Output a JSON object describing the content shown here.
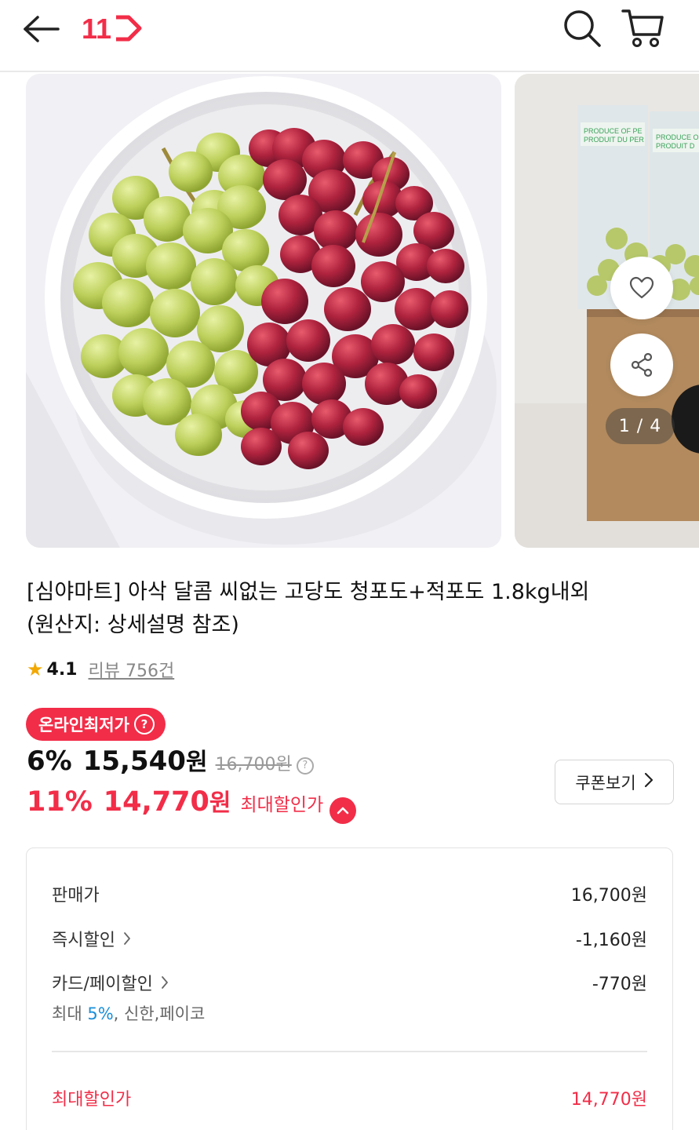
{
  "header": {
    "logo_text": "11",
    "brand_color": "#f22d48"
  },
  "gallery": {
    "page_indicator": "1 / 4",
    "package_label_1": "PRODUCE OF PE\nPRODUIT DU PER",
    "package_label_2": "PRODUCE O\nPRODUIT D"
  },
  "product": {
    "title_line1": "[심야마트] 아삭 달콤 씨없는 고당도 청포도+적포도 1.8kg내외",
    "title_line2": "(원산지: 상세설명 참조)",
    "rating_score": "4.1",
    "review_text": "리뷰 756건"
  },
  "pricing": {
    "badge_label": "온라인최저가",
    "discount_pct": "6%",
    "sale_price": "15,540",
    "won": "원",
    "original_price": "16,700원",
    "max_discount_pct": "11%",
    "max_price": "14,770",
    "max_label": "최대할인가",
    "coupon_button": "쿠폰보기"
  },
  "breakdown": {
    "rows": [
      {
        "label": "판매가",
        "value": "16,700원"
      },
      {
        "label": "즉시할인",
        "value": "-1,160원"
      },
      {
        "label": "카드/페이할인",
        "value": "-770원"
      }
    ],
    "card_note_prefix": "최대 ",
    "card_note_highlight": "5%",
    "card_note_suffix": ", 신한,페이코",
    "total_label": "최대할인가",
    "total_value": "14,770원"
  }
}
